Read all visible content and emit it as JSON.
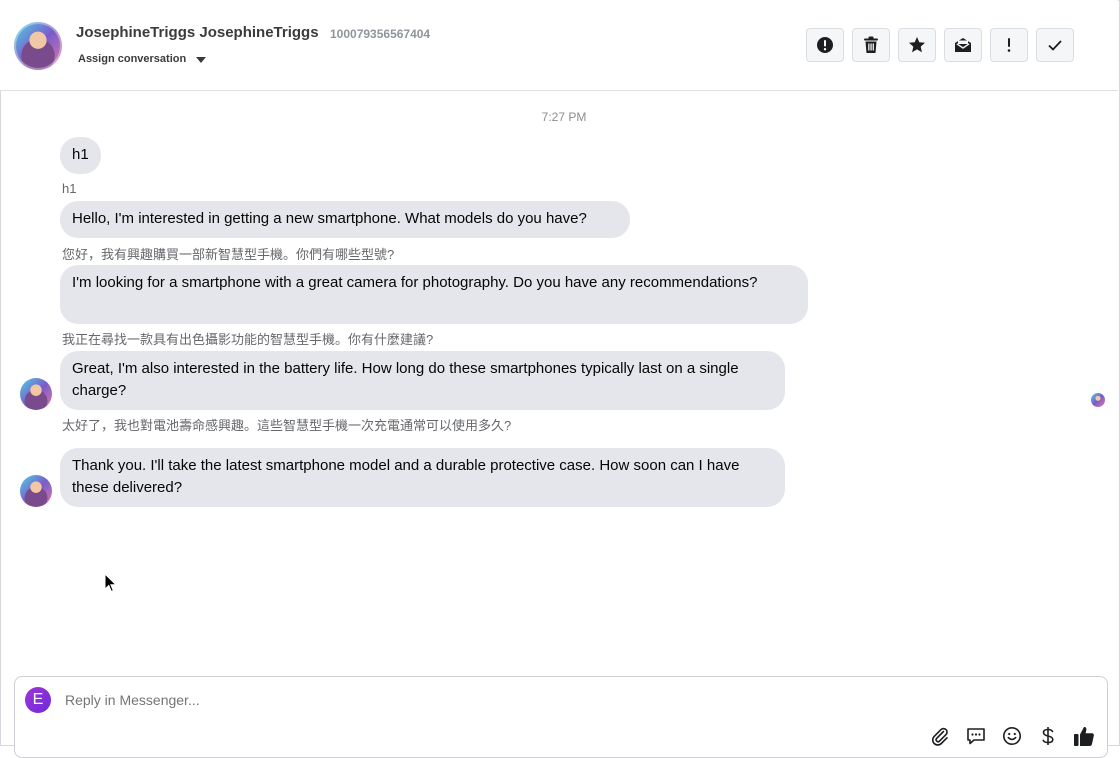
{
  "header": {
    "name": "JosephineTriggs JosephineTriggs",
    "user_id": "100079356567404",
    "assign_label": "Assign conversation",
    "toolbar_icons": [
      "alert-circle-icon",
      "trash-icon",
      "star-icon",
      "mark-unread-icon",
      "exclamation-icon",
      "check-icon"
    ]
  },
  "conversation": {
    "timestamp": "7:27 PM",
    "messages": [
      {
        "text": "h1",
        "translation": "h1"
      },
      {
        "text": "Hello, I'm interested in getting a new smartphone. What models do you have?",
        "translation": "您好，我有興趣購買一部新智慧型手機。你們有哪些型號?"
      },
      {
        "text": "I'm looking for a smartphone with a great camera for photography. Do you have any recommendations?",
        "translation": "我正在尋找一款具有出色攝影功能的智慧型手機。你有什麼建議?"
      },
      {
        "text": "Great, I'm also interested in the battery life. How long do these smartphones typically last on a single charge?",
        "translation": "太好了，我也對電池壽命感興趣。這些智慧型手機一次充電通常可以使用多久?"
      },
      {
        "text": "Thank you. I'll take the latest smartphone model and a durable protective case. How soon can I have these delivered?",
        "translation": ""
      }
    ]
  },
  "reply": {
    "avatar_letter": "E",
    "placeholder": "Reply in Messenger...",
    "tool_icons": [
      "paperclip-icon",
      "saved-reply-icon",
      "emoji-icon",
      "dollar-icon",
      "thumbs-up-icon"
    ]
  },
  "colors": {
    "bubble": "#e4e6eb",
    "toolbar_button": "#f5f6f7",
    "reply_avatar": "#8a30d8",
    "meta_text": "#65676b"
  }
}
